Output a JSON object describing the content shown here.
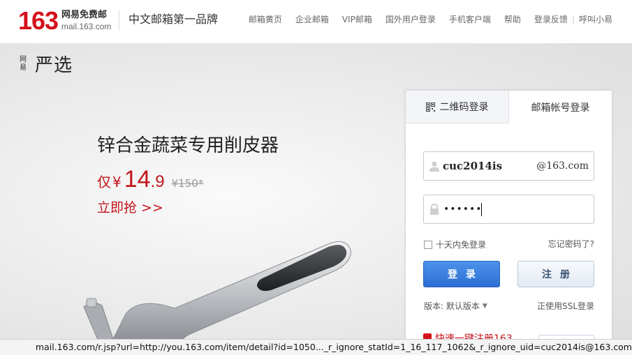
{
  "header": {
    "logo_number": "163",
    "logo_cn": "网易免费邮",
    "logo_en": "mail.163.com",
    "slogan": "中文邮箱第一品牌",
    "nav": [
      "邮箱黄页",
      "企业邮箱",
      "VIP邮箱",
      "国外用户登录",
      "手机客户端",
      "帮助",
      "登录反馈",
      "|",
      "呼叫小易"
    ]
  },
  "banner": {
    "brand_small": "网易",
    "brand_big": "严选",
    "title": "锌合金蔬菜专用削皮器",
    "price_prefix": "仅",
    "currency": "¥",
    "price_int": "14",
    "price_dec": ".9",
    "old_price": "¥150*",
    "buy_label": "立即抢 >>"
  },
  "login": {
    "tab_qr": "二维码登录",
    "tab_mail": "邮箱帐号登录",
    "username": "cuc2014is",
    "domain_suffix": "@163.com",
    "password_mask": "••••••",
    "remember_label": "十天内免登录",
    "forgot_label": "忘记密码了?",
    "login_button": "登录",
    "register_button": "注册",
    "version_label": "版本: 默认版本",
    "ssl_label": "正使用SSL登录",
    "bottom_promo": "快速一键注册163"
  },
  "status_bar": {
    "url": "mail.163.com/r.jsp?url=http://you.163.com/item/detail?id=1050..._r_ignore_statId=1_16_117_1062&_r_ignore_uid=cuc2014is@163.com"
  },
  "colors": {
    "brand_red": "#d4121b",
    "price_red": "#c4141b",
    "login_blue": "#2c6fd4"
  }
}
